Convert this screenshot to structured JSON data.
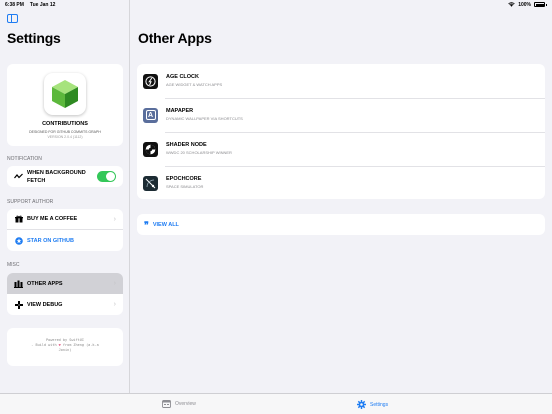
{
  "status": {
    "time": "6:38 PM",
    "date": "Tue Jan 12",
    "battery": "100%"
  },
  "sidebar": {
    "title": "Settings",
    "app": {
      "name": "CONTRIBUTIONS",
      "subtitle": "DESIGNED FOR GITHUB COMMITS GRAPH",
      "version": "VERSION 2.0.4 (1112)"
    },
    "notification": {
      "header": "NOTIFICATION",
      "label": "WHEN BACKGROUND FETCH",
      "enabled": true
    },
    "support": {
      "header": "SUPPORT AUTHOR",
      "buy_coffee": "BUY ME A COFFEE",
      "star_github": "STAR ON GITHUB"
    },
    "misc": {
      "header": "MISC",
      "other_apps": "OTHER APPS",
      "view_debug": "VIEW DEBUG"
    },
    "footer": {
      "line1": "Powered by SwiftUI",
      "line2": "- Build with",
      "line3": "from Zheng (a.k.a",
      "line4": "Jonin)"
    }
  },
  "main": {
    "title": "Other Apps",
    "apps": [
      {
        "name": "AGE CLOCK",
        "desc": "AGE WIDGET & WATCH APPS",
        "icon": "age-clock-icon",
        "color": "#111111"
      },
      {
        "name": "MAPAPER",
        "desc": "DYNAMIC WALLPAPER VIA SHORTCUTS",
        "icon": "mapaper-icon",
        "color": "#5a6e9c"
      },
      {
        "name": "SHADER NODE",
        "desc": "WWDC 20 SCHOLARSHIP WINNER",
        "icon": "shader-node-icon",
        "color": "#111111"
      },
      {
        "name": "EPOCHCORE",
        "desc": "SPACE SIMULATOR",
        "icon": "epochcore-icon",
        "color": "#1c2b33"
      }
    ],
    "view_all": "VIEW ALL"
  },
  "tabs": [
    {
      "label": "Overview",
      "icon": "overview-icon",
      "selected": false
    },
    {
      "label": "Settings",
      "icon": "gear-icon",
      "selected": true
    }
  ],
  "colors": {
    "accent": "#1e7cf2",
    "toggle": "#34c759",
    "heart": "#e0245e"
  }
}
